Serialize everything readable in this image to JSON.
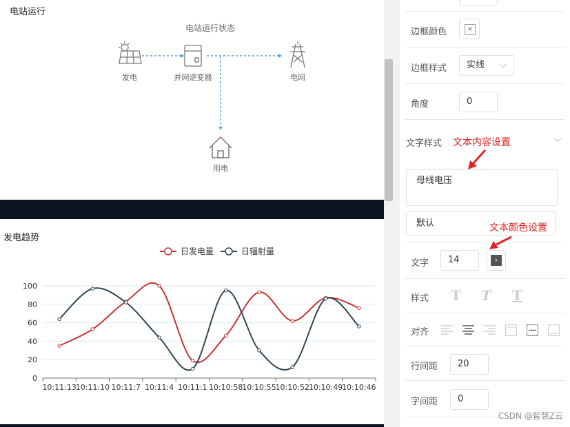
{
  "station": {
    "panel_title": "电站运行",
    "diagram_title": "电站运行状态",
    "nodes": {
      "generate": "发电",
      "inverter": "并网逆变器",
      "grid": "电网",
      "consume": "用电"
    }
  },
  "trend": {
    "panel_title": "发电趋势"
  },
  "chart_data": {
    "type": "line",
    "categories": [
      "10:11:13",
      "10:11:10",
      "10:11:7",
      "10:11:4",
      "10:11:1",
      "10:10:58",
      "10:10:55",
      "10:10:52",
      "10:10:49",
      "10:10:46"
    ],
    "ylim": [
      0,
      100
    ],
    "yticks": [
      "0",
      "20",
      "40",
      "60",
      "80",
      "100"
    ],
    "grid": true,
    "legend_placement": "top",
    "series": [
      {
        "name": "日发电量",
        "color": "#c23531",
        "values": [
          35,
          53,
          83,
          100,
          19,
          46,
          93,
          62,
          87,
          76
        ]
      },
      {
        "name": "日辐射量",
        "color": "#2f4554",
        "values": [
          64,
          97,
          82,
          44,
          10,
          95,
          30,
          12,
          86,
          56
        ]
      }
    ]
  },
  "props": {
    "border_color_label": "边框颜色",
    "border_color_clear": "×",
    "border_style_label": "边框样式",
    "border_style_value": "实线",
    "angle_label": "角度",
    "angle_value": "0",
    "text_style_label": "文字样式",
    "text_content_value": "母线电压",
    "font_value": "默认",
    "text_label": "文字",
    "text_size_value": "14",
    "style_label": "样式",
    "align_label": "对齐",
    "line_height_label": "行间距",
    "line_height_value": "20",
    "letter_spacing_label": "字间距",
    "letter_spacing_value": "0"
  },
  "annotations": {
    "content": "文本内容设置",
    "color": "文本颜色设置"
  },
  "watermark": "CSDN @智慧Z云"
}
